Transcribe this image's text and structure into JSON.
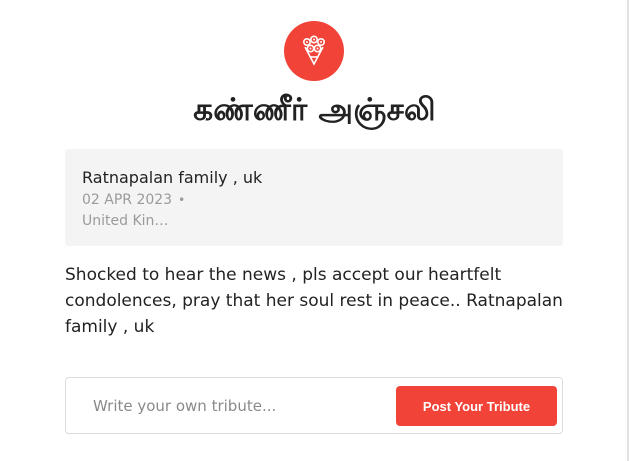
{
  "header": {
    "badge_icon": "flower-bouquet-icon",
    "title": "கண்ணீர் அஞ்சலி"
  },
  "tribute": {
    "author": "Ratnapalan family , uk",
    "date": "02 APR 2023",
    "separator": "•",
    "location": "United Kin…",
    "message": "Shocked to hear the news , pls accept our heartfelt condolences, pray that her soul rest in peace.. Ratnapalan family , uk"
  },
  "composer": {
    "placeholder": "Write your own tribute...",
    "button_label": "Post Your Tribute"
  },
  "colors": {
    "accent": "#f14338",
    "card_background": "#f4f4f4",
    "text": "#222222",
    "muted": "#9a9a9a"
  }
}
